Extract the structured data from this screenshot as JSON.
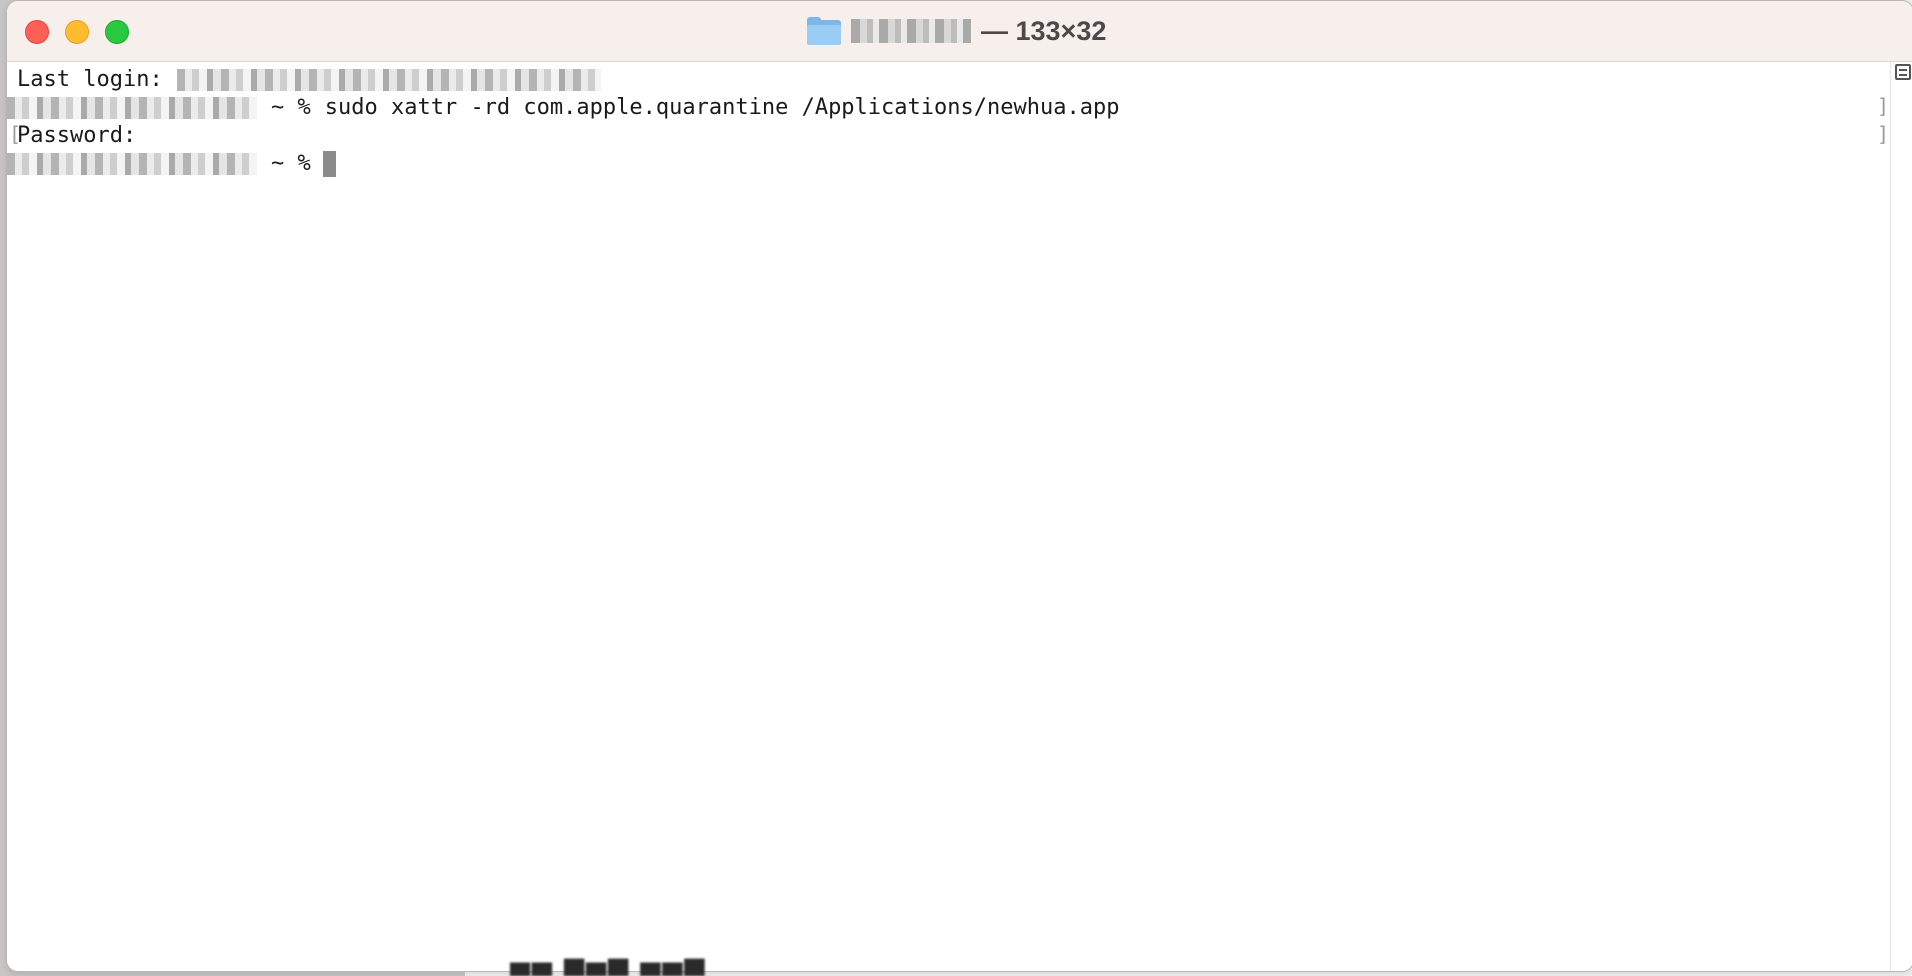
{
  "window": {
    "title_size": "— 133×32"
  },
  "terminal": {
    "lines": [
      {
        "label": "Last login:"
      },
      {
        "prompt_suffix": "~ %",
        "command": "sudo xattr -rd com.apple.quarantine /Applications/newhua.app"
      },
      {
        "label": "Password:"
      },
      {
        "prompt_suffix": "~ %"
      }
    ]
  },
  "colors": {
    "close": "#ff5f57",
    "minimize": "#febc2e",
    "maximize": "#28c840",
    "titlebar": "#f6efec",
    "cursor": "#8b8b8b"
  },
  "icons": [
    "close-icon",
    "minimize-icon",
    "maximize-icon",
    "folder-icon",
    "marks-icon"
  ]
}
